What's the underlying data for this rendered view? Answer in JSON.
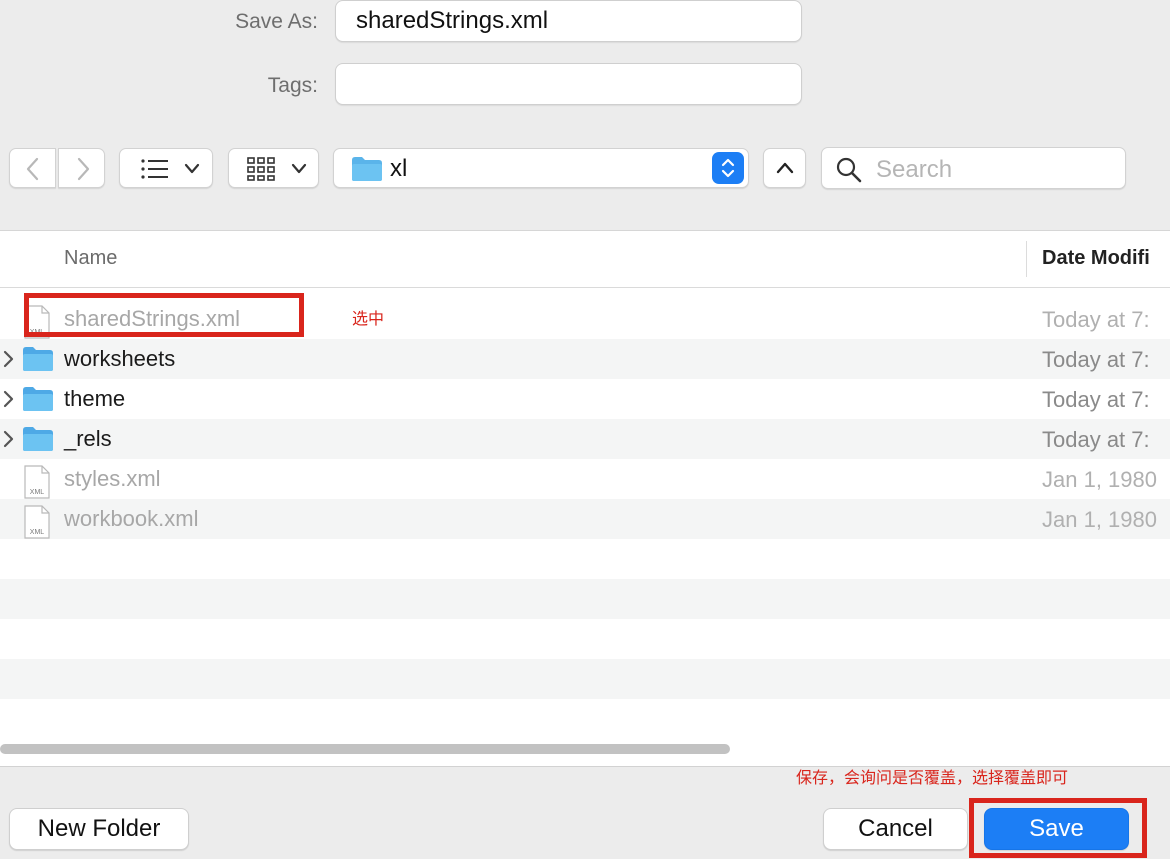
{
  "dialog": {
    "save_as_label": "Save As:",
    "save_as_value": "sharedStrings.xml",
    "tags_label": "Tags:",
    "tags_value": ""
  },
  "toolbar": {
    "back_icon": "chevron-left-icon",
    "forward_icon": "chevron-right-icon",
    "list_view_icon": "list-icon",
    "grid_view_icon": "grid-icon",
    "location": "xl",
    "search_placeholder": "Search"
  },
  "columns": {
    "name": "Name",
    "date": "Date Modifi"
  },
  "files": [
    {
      "name": "sharedStrings.xml",
      "date": "Today at 7:",
      "type": "xml",
      "enabled": false
    },
    {
      "name": "worksheets",
      "date": "Today at 7:",
      "type": "folder",
      "enabled": true
    },
    {
      "name": "theme",
      "date": "Today at 7:",
      "type": "folder",
      "enabled": true
    },
    {
      "name": "_rels",
      "date": "Today at 7:",
      "type": "folder",
      "enabled": true
    },
    {
      "name": "styles.xml",
      "date": "Jan 1, 1980",
      "type": "xml",
      "enabled": false
    },
    {
      "name": "workbook.xml",
      "date": "Jan 1, 1980",
      "type": "xml",
      "enabled": false
    }
  ],
  "buttons": {
    "new_folder": "New Folder",
    "cancel": "Cancel",
    "save": "Save"
  },
  "annotations": {
    "select_note": "选中",
    "save_note": "保存，会询问是否覆盖，选择覆盖即可",
    "color": "#d9251c"
  },
  "colors": {
    "accent": "#1c7ef5",
    "folder": "#5ab4ea"
  }
}
